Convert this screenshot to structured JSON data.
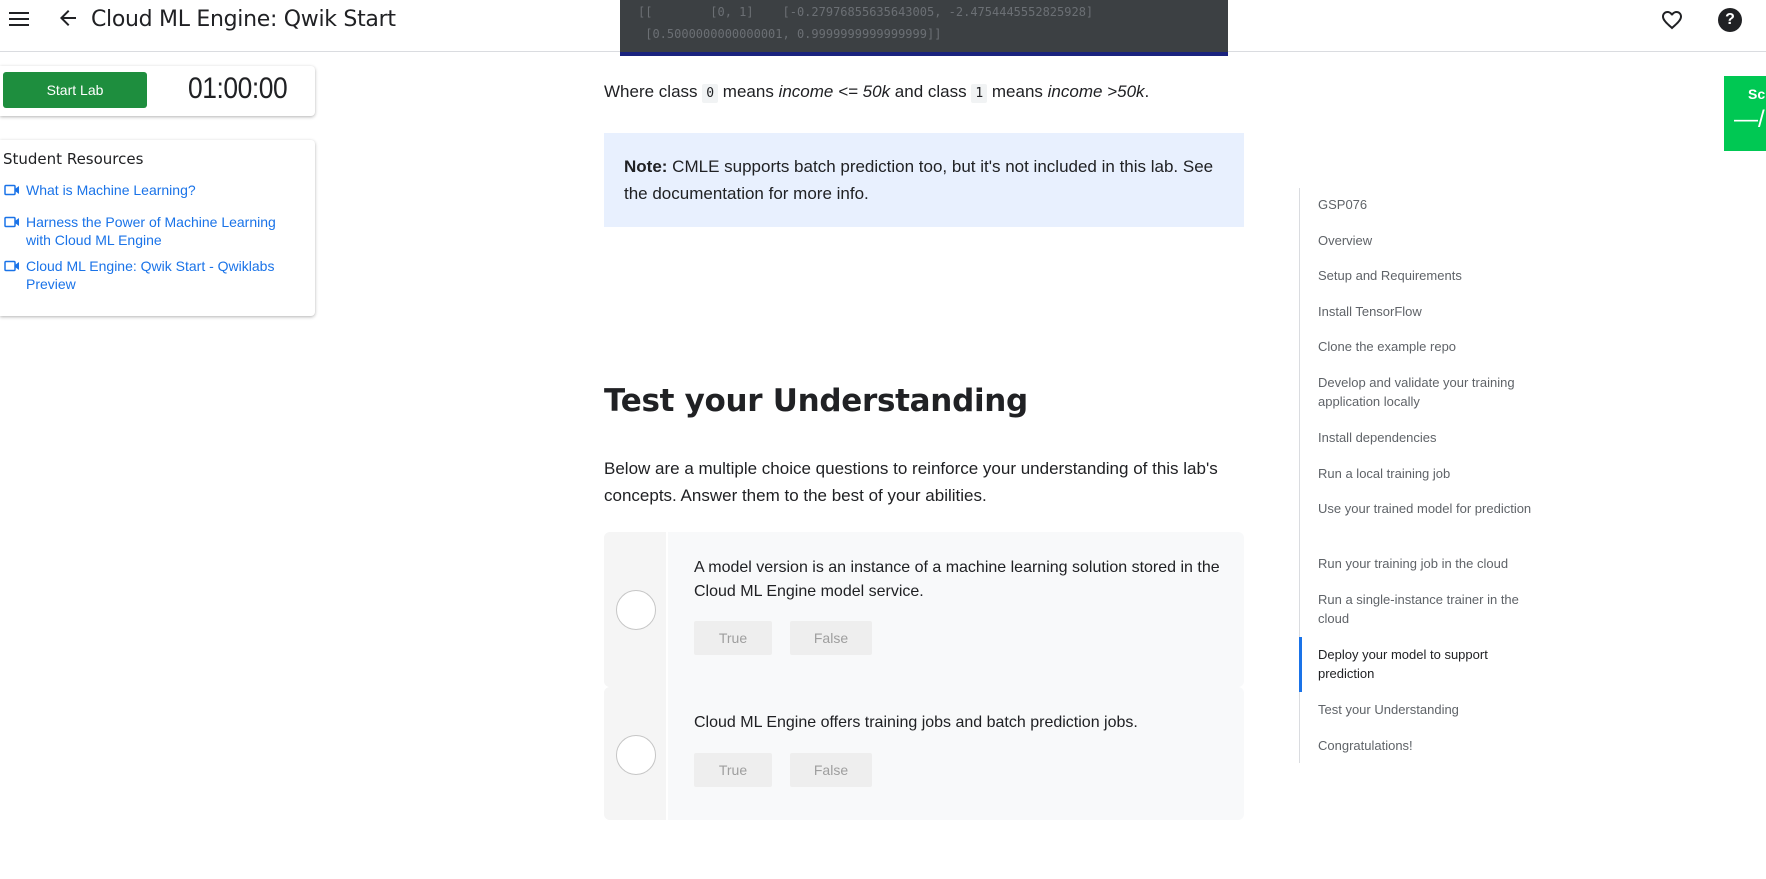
{
  "header": {
    "title": "Cloud ML Engine: Qwik Start"
  },
  "code_snippet": {
    "lines": [
      "[[        [0, 1]    [-0.27976855635643005, -2.4754445552825928]",
      " [0.5000000000000001, 0.9999999999999999]]"
    ]
  },
  "lab": {
    "start_label": "Start Lab",
    "timer": "01:00:00"
  },
  "resources": {
    "title": "Student Resources",
    "links": [
      {
        "label": "What is Machine Learning?",
        "icon": "video-icon"
      },
      {
        "label": "Harness the Power of Machine Learning with Cloud ML Engine",
        "icon": "video-icon"
      },
      {
        "label": "Cloud ML Engine: Qwik Start - Qwiklabs Preview",
        "icon": "video-icon"
      }
    ]
  },
  "content": {
    "where_prefix": "Where class ",
    "class0_code": "0",
    "means1": " means ",
    "class0_meaning": "income <= 50k",
    "and_class": " and class ",
    "class1_code": "1",
    "means2": " means ",
    "class1_meaning": "income >50k",
    "period": ".",
    "note_bold": "Note:",
    "note_text": " CMLE supports batch prediction too, but it's not included in this lab. See the documentation for more info.",
    "section_title": "Test your Understanding",
    "intro": "Below are a multiple choice questions to reinforce your understanding of this lab's concepts. Answer them to the best of your abilities.",
    "questions": [
      {
        "text": "A model version is an instance of a machine learning solution stored in the Cloud ML Engine model service.",
        "options": [
          "True",
          "False"
        ]
      },
      {
        "text": "Cloud ML Engine offers training jobs and batch prediction jobs.",
        "options": [
          "True",
          "False"
        ]
      }
    ]
  },
  "toc": {
    "items": [
      "GSP076",
      "Overview",
      "Setup and Requirements",
      "Install TensorFlow",
      "Clone the example repo",
      "Develop and validate your training application locally",
      "Install dependencies",
      "Run a local training job",
      "Use your trained model for prediction",
      "Run your training job in the cloud",
      "Run a single-instance trainer in the cloud",
      "Deploy your model to support prediction",
      "Test your Understanding",
      "Congratulations!"
    ],
    "active_index": 11
  },
  "score_widget": {
    "label": "Sc",
    "value": "—/"
  },
  "colors": {
    "primary_green": "#1e8e3e",
    "link_blue": "#1a73e8",
    "note_bg": "#e8f0fe",
    "score_green": "#00c853"
  }
}
